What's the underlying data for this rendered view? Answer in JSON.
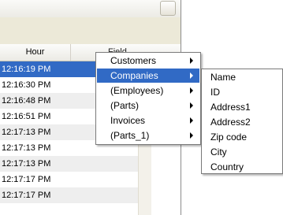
{
  "grid": {
    "column_hour": "Hour",
    "column_field": "Field",
    "rows": [
      "12:16:19 PM",
      "12:16:30 PM",
      "12:16:48 PM",
      "12:16:51 PM",
      "12:17:13 PM",
      "12:17:13 PM",
      "12:17:13 PM",
      "12:17:17 PM",
      "12:17:17 PM"
    ],
    "selected_row": 0
  },
  "context_menu": {
    "items": [
      "Customers",
      "Companies",
      "(Employees)",
      "(Parts)",
      "Invoices",
      "(Parts_1)"
    ],
    "highlighted": "Companies"
  },
  "submenu": {
    "items": [
      "Name",
      "ID",
      "Address1",
      "Address2",
      "Zip code",
      "City",
      "Country"
    ]
  },
  "colors": {
    "selection": "#316ac5",
    "alt_row": "#eeeeee",
    "window_face": "#ece9d8"
  }
}
